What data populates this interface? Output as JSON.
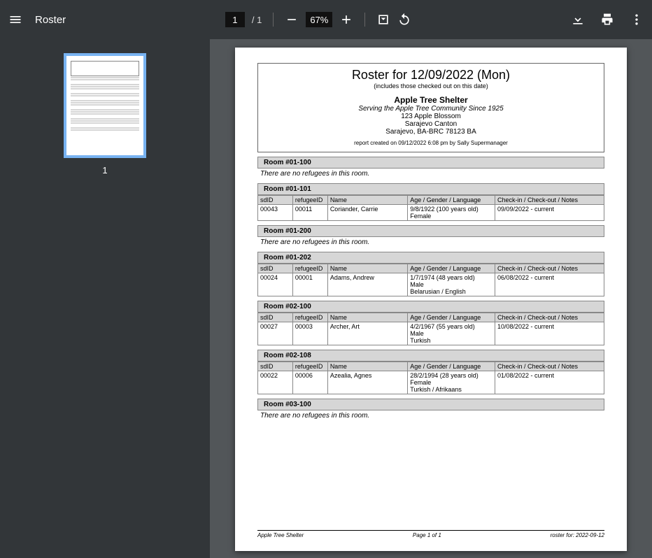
{
  "toolbar": {
    "title": "Roster",
    "page_input": "1",
    "page_total": "/  1",
    "zoom": "67%"
  },
  "sidebar": {
    "thumb_label": "1"
  },
  "doc": {
    "title": "Roster for 12/09/2022 (Mon)",
    "subtitle": "(includes those checked out on this date)",
    "shelter": "Apple Tree Shelter",
    "tagline": "Serving the Apple Tree Community Since 1925",
    "addr1": "123 Apple Blossom",
    "addr2": "Sarajevo Canton",
    "addr3": "Sarajevo, BA-BRC 78123 BA",
    "created": "report created on 09/12/2022 6:08 pm by Sally Supermanager",
    "columns": {
      "sd": "sdID",
      "ref": "refugeeID",
      "name": "Name",
      "age": "Age / Gender / Language",
      "check": "Check-in / Check-out / Notes"
    },
    "no_refugees_text": "There are no refugees in this room.",
    "rooms": [
      {
        "title": "Room #01-100",
        "empty": true
      },
      {
        "title": "Room #01-101",
        "rows": [
          {
            "sd": "00043",
            "ref": "00011",
            "name": "Coriander, Carrie",
            "age": "9/8/1922 (100 years old)\nFemale",
            "check": "09/09/2022 - current"
          }
        ]
      },
      {
        "title": "Room #01-200",
        "empty": true
      },
      {
        "title": "Room #01-202",
        "rows": [
          {
            "sd": "00024",
            "ref": "00001",
            "name": "Adams, Andrew",
            "age": "1/7/1974 (48 years old)\nMale\nBelarusian / English",
            "check": "06/08/2022 - current"
          }
        ]
      },
      {
        "title": "Room #02-100",
        "rows": [
          {
            "sd": "00027",
            "ref": "00003",
            "name": "Archer, Art",
            "age": "4/2/1967 (55 years old)\nMale\nTurkish",
            "check": "10/08/2022 - current"
          }
        ]
      },
      {
        "title": "Room #02-108",
        "rows": [
          {
            "sd": "00022",
            "ref": "00006",
            "name": "Azealia, Agnes",
            "age": "28/2/1994 (28 years old)\nFemale\nTurkish / Afrikaans",
            "check": "01/08/2022 - current"
          }
        ]
      },
      {
        "title": "Room #03-100",
        "empty": true
      }
    ],
    "footer": {
      "left": "Apple Tree Shelter",
      "center": "Page 1 of 1",
      "right": "roster for: 2022-09-12"
    }
  }
}
